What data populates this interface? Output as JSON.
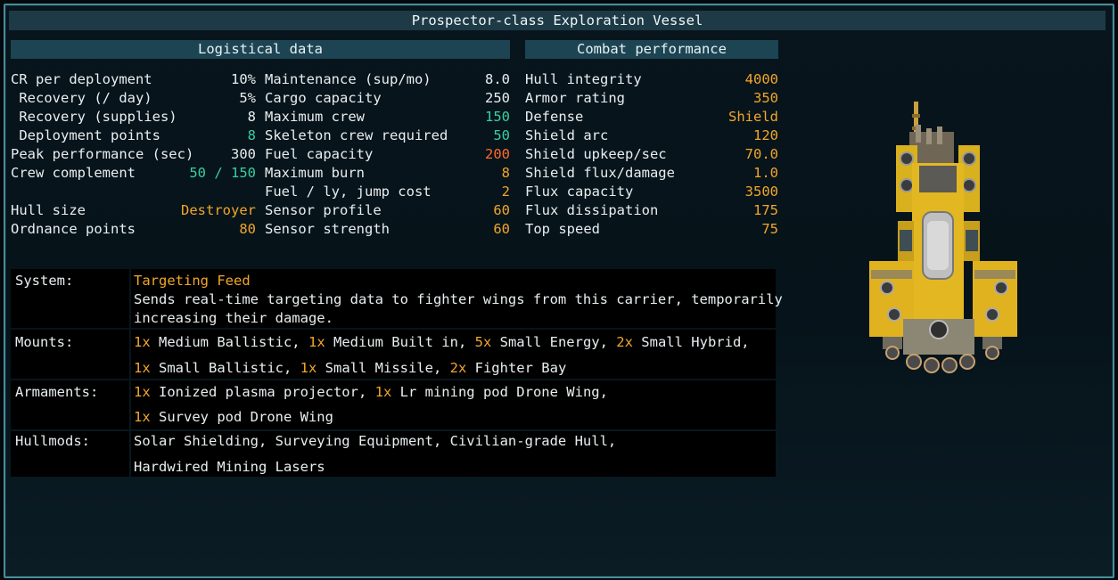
{
  "title": "Prospector-class Exploration Vessel",
  "logistical": {
    "header": "Logistical data",
    "left": [
      {
        "label": "CR per deployment",
        "value": "10%",
        "vc": "w"
      },
      {
        "label": " Recovery (/ day)",
        "value": "5%",
        "vc": "w"
      },
      {
        "label": " Recovery (supplies)",
        "value": "8",
        "vc": "w"
      },
      {
        "label": " Deployment points",
        "value": "8",
        "vc": "g"
      },
      {
        "label": "Peak performance (sec)",
        "value": "300",
        "vc": "w"
      },
      {
        "label": "Crew complement",
        "value": "50 / 150",
        "vc": "g"
      },
      {
        "label": "",
        "value": "",
        "vc": "w"
      },
      {
        "label": "Hull size",
        "value": "Destroyer",
        "vc": "o"
      },
      {
        "label": "Ordnance points",
        "value": "80",
        "vc": "o"
      }
    ],
    "right": [
      {
        "label": "Maintenance (sup/mo)",
        "value": "8.0",
        "vc": "w"
      },
      {
        "label": "Cargo capacity",
        "value": "250",
        "vc": "w"
      },
      {
        "label": "Maximum crew",
        "value": "150",
        "vc": "g"
      },
      {
        "label": "Skeleton crew required",
        "value": "50",
        "vc": "g"
      },
      {
        "label": "Fuel capacity",
        "value": "200",
        "vc": "r"
      },
      {
        "label": "Maximum burn",
        "value": "8",
        "vc": "o"
      },
      {
        "label": "Fuel / ly, jump cost",
        "value": "2",
        "vc": "o"
      },
      {
        "label": "Sensor profile",
        "value": "60",
        "vc": "o"
      },
      {
        "label": "Sensor strength",
        "value": "60",
        "vc": "o"
      }
    ]
  },
  "combat": {
    "header": "Combat performance",
    "rows": [
      {
        "label": "Hull integrity",
        "value": "4000",
        "vc": "o"
      },
      {
        "label": "Armor rating",
        "value": "350",
        "vc": "o"
      },
      {
        "label": "Defense",
        "value": "Shield",
        "vc": "o"
      },
      {
        "label": "Shield arc",
        "value": "120",
        "vc": "o"
      },
      {
        "label": "Shield upkeep/sec",
        "value": "70.0",
        "vc": "o"
      },
      {
        "label": "Shield flux/damage",
        "value": "1.0",
        "vc": "o"
      },
      {
        "label": "Flux capacity",
        "value": "3500",
        "vc": "o"
      },
      {
        "label": "Flux dissipation",
        "value": "175",
        "vc": "o"
      },
      {
        "label": "Top speed",
        "value": "75",
        "vc": "o"
      }
    ]
  },
  "info": {
    "system": {
      "label": "System:",
      "name": "Targeting Feed",
      "desc1": "Sends real-time targeting data to fighter wings from this carrier, temporarily",
      "desc2": "increasing their damage."
    },
    "mounts": {
      "label": "Mounts:",
      "line1": [
        {
          "n": "1x",
          "t": " Medium Ballistic, "
        },
        {
          "n": "1x",
          "t": " Medium Built in, "
        },
        {
          "n": "5x",
          "t": " Small Energy, "
        },
        {
          "n": "2x",
          "t": " Small Hybrid,"
        }
      ],
      "line2": [
        {
          "n": "1x",
          "t": " Small Ballistic, "
        },
        {
          "n": "1x",
          "t": " Small Missile, "
        },
        {
          "n": "2x",
          "t": " Fighter Bay"
        }
      ]
    },
    "armaments": {
      "label": "Armaments:",
      "line1": [
        {
          "n": "1x",
          "t": " Ionized plasma projector, "
        },
        {
          "n": "1x",
          "t": " Lr mining pod Drone Wing,"
        }
      ],
      "line2": [
        {
          "n": "1x",
          "t": " Survey pod Drone Wing"
        }
      ]
    },
    "hullmods": {
      "label": "Hullmods:",
      "line1": "Solar Shielding, Surveying Equipment, Civilian-grade Hull,",
      "line2": "Hardwired Mining Lasers"
    }
  },
  "colors": {
    "orange": "#f2a62b",
    "green": "#37d0a2",
    "red": "#ff6a2e",
    "frame": "#4b8c9a"
  },
  "ship_icon": "ship-sprite"
}
